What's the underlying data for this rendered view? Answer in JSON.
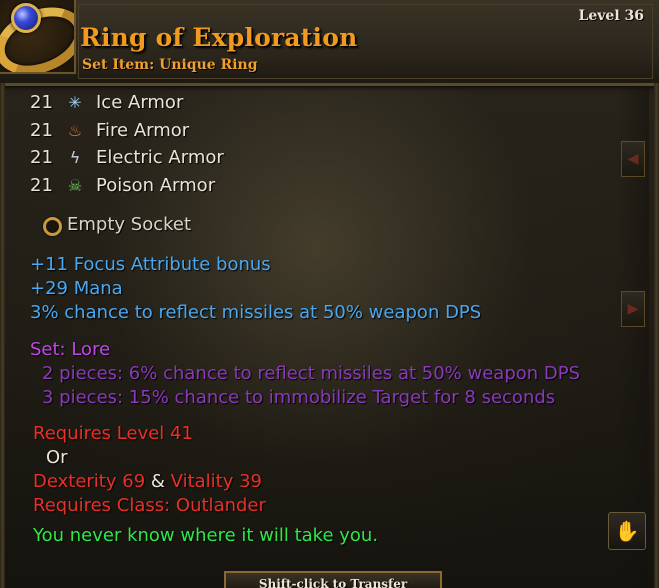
{
  "header": {
    "item_name": "Ring of Exploration",
    "item_type": "Set Item: Unique Ring",
    "level": "Level 36",
    "icon": "ring-icon"
  },
  "armor": [
    {
      "value": "21",
      "name": "Ice Armor",
      "icon": "snowflake-icon",
      "glyph": "✳"
    },
    {
      "value": "21",
      "name": "Fire Armor",
      "icon": "flame-icon",
      "glyph": "🔥"
    },
    {
      "value": "21",
      "name": "Electric Armor",
      "icon": "lightning-icon",
      "glyph": "⚡"
    },
    {
      "value": "21",
      "name": "Poison Armor",
      "icon": "skull-icon",
      "glyph": "☠"
    }
  ],
  "socket": {
    "label": "Empty Socket"
  },
  "bonuses": [
    "+11 Focus Attribute bonus",
    "+29 Mana",
    "3% chance to reflect missiles at 50% weapon DPS"
  ],
  "set": {
    "title": "Set: Lore",
    "pieces": [
      "2 pieces: 6% chance to reflect missiles at 50% weapon DPS",
      "3 pieces: 15% chance to immobilize Target for 8 seconds"
    ]
  },
  "requirements": {
    "level": "Requires Level 41",
    "or": "Or",
    "dexterity": "Dexterity 69",
    "amp": "&",
    "vitality": "Vitality 39",
    "class": "Requires Class: Outlander"
  },
  "flavor": "You never know where it will take you.",
  "footer": {
    "transfer_label": "Shift-click to Transfer"
  },
  "colors": {
    "name_orange": "#f29a1e",
    "bonus_blue": "#4aa8f0",
    "set_purple": "#c048e8",
    "set_piece_purple": "#8a3ab8",
    "requirement_red": "#e8302a",
    "flavor_green": "#2ee84a"
  }
}
